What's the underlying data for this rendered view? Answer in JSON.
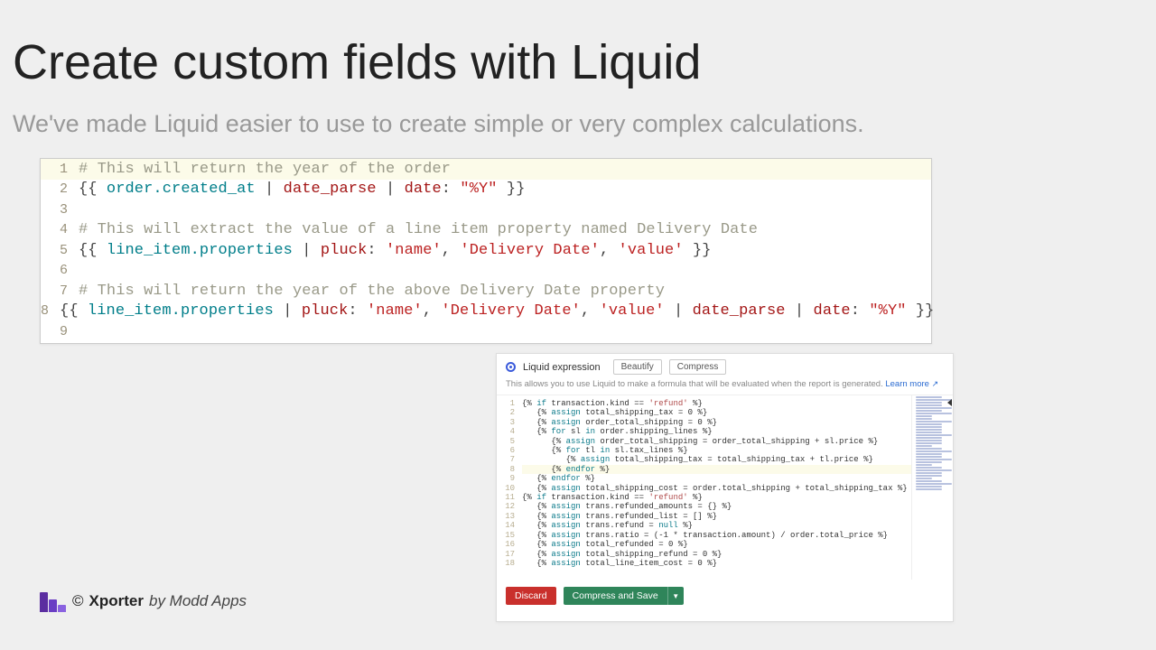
{
  "title": "Create custom fields with Liquid",
  "subtitle": "We've made Liquid easier to use to create simple or very complex calculations.",
  "code_main": {
    "lines": [
      {
        "n": 1,
        "hl": true,
        "tokens": [
          [
            "cm",
            "# This will return the year of the order"
          ]
        ]
      },
      {
        "n": 2,
        "hl": false,
        "tokens": [
          [
            "br",
            "{{ "
          ],
          [
            "va",
            "order.created_at"
          ],
          [
            "br",
            " | "
          ],
          [
            "fn",
            "date_parse"
          ],
          [
            "br",
            " | "
          ],
          [
            "fn",
            "date"
          ],
          [
            "br",
            ": "
          ],
          [
            "st",
            "\"%Y\""
          ],
          [
            "br",
            " }}"
          ]
        ]
      },
      {
        "n": 3,
        "hl": false,
        "tokens": [
          [
            "br",
            ""
          ]
        ]
      },
      {
        "n": 4,
        "hl": false,
        "tokens": [
          [
            "cm",
            "# This will extract the value of a line item property named Delivery Date"
          ]
        ]
      },
      {
        "n": 5,
        "hl": false,
        "tokens": [
          [
            "br",
            "{{ "
          ],
          [
            "va",
            "line_item.properties"
          ],
          [
            "br",
            " | "
          ],
          [
            "fn",
            "pluck"
          ],
          [
            "br",
            ": "
          ],
          [
            "st",
            "'name'"
          ],
          [
            "br",
            ", "
          ],
          [
            "st",
            "'Delivery Date'"
          ],
          [
            "br",
            ", "
          ],
          [
            "st",
            "'value'"
          ],
          [
            "br",
            " }}"
          ]
        ]
      },
      {
        "n": 6,
        "hl": false,
        "tokens": [
          [
            "br",
            ""
          ]
        ]
      },
      {
        "n": 7,
        "hl": false,
        "tokens": [
          [
            "cm",
            "# This will return the year of the above Delivery Date property"
          ]
        ]
      },
      {
        "n": 8,
        "hl": false,
        "tokens": [
          [
            "br",
            "{{ "
          ],
          [
            "va",
            "line_item.properties"
          ],
          [
            "br",
            " | "
          ],
          [
            "fn",
            "pluck"
          ],
          [
            "br",
            ": "
          ],
          [
            "st",
            "'name'"
          ],
          [
            "br",
            ", "
          ],
          [
            "st",
            "'Delivery Date'"
          ],
          [
            "br",
            ", "
          ],
          [
            "st",
            "'value'"
          ],
          [
            "br",
            " | "
          ],
          [
            "fn",
            "date_parse"
          ],
          [
            "br",
            " | "
          ],
          [
            "fn",
            "date"
          ],
          [
            "br",
            ": "
          ],
          [
            "st",
            "\"%Y\""
          ],
          [
            "br",
            " }}"
          ]
        ]
      },
      {
        "n": 9,
        "hl": false,
        "tokens": [
          [
            "br",
            ""
          ]
        ]
      }
    ]
  },
  "panel": {
    "radio_label": "Liquid expression",
    "beautify": "Beautify",
    "compress": "Compress",
    "hint": "This allows you to use Liquid to make a formula that will be evaluated when the report is generated.",
    "learn_more": "Learn more",
    "mini_code": {
      "lines": [
        {
          "n": 1,
          "t": "{% if transaction.kind == 'refund' %}"
        },
        {
          "n": 2,
          "t": "   {% assign total_shipping_tax = 0 %}"
        },
        {
          "n": 3,
          "t": "   {% assign order_total_shipping = 0 %}"
        },
        {
          "n": 4,
          "t": "   {% for sl in order.shipping_lines %}"
        },
        {
          "n": 5,
          "t": "      {% assign order_total_shipping = order_total_shipping + sl.price %}"
        },
        {
          "n": 6,
          "t": "      {% for tl in sl.tax_lines %}"
        },
        {
          "n": 7,
          "t": "         {% assign total_shipping_tax = total_shipping_tax + tl.price %}"
        },
        {
          "n": 8,
          "t": "      {% endfor %}",
          "hl": true
        },
        {
          "n": 9,
          "t": "   {% endfor %}"
        },
        {
          "n": 10,
          "t": "   {% assign total_shipping_cost = order.total_shipping + total_shipping_tax %}"
        },
        {
          "n": 11,
          "t": "{% if transaction.kind == 'refund' %}"
        },
        {
          "n": 12,
          "t": "   {% assign trans.refunded_amounts = {} %}"
        },
        {
          "n": 13,
          "t": "   {% assign trans.refunded_list = [] %}"
        },
        {
          "n": 14,
          "t": "   {% assign trans.refund = null %}"
        },
        {
          "n": 15,
          "t": "   {% assign trans.ratio = (-1 * transaction.amount) / order.total_price %}"
        },
        {
          "n": 16,
          "t": "   {% assign total_refunded = 0 %}"
        },
        {
          "n": 17,
          "t": "   {% assign total_shipping_refund = 0 %}"
        },
        {
          "n": 18,
          "t": "   {% assign total_line_item_cost = 0 %}"
        }
      ]
    },
    "discard": "Discard",
    "save": "Compress and Save"
  },
  "footer": {
    "copyright": "©",
    "product": "Xporter",
    "by": "by Modd Apps"
  }
}
